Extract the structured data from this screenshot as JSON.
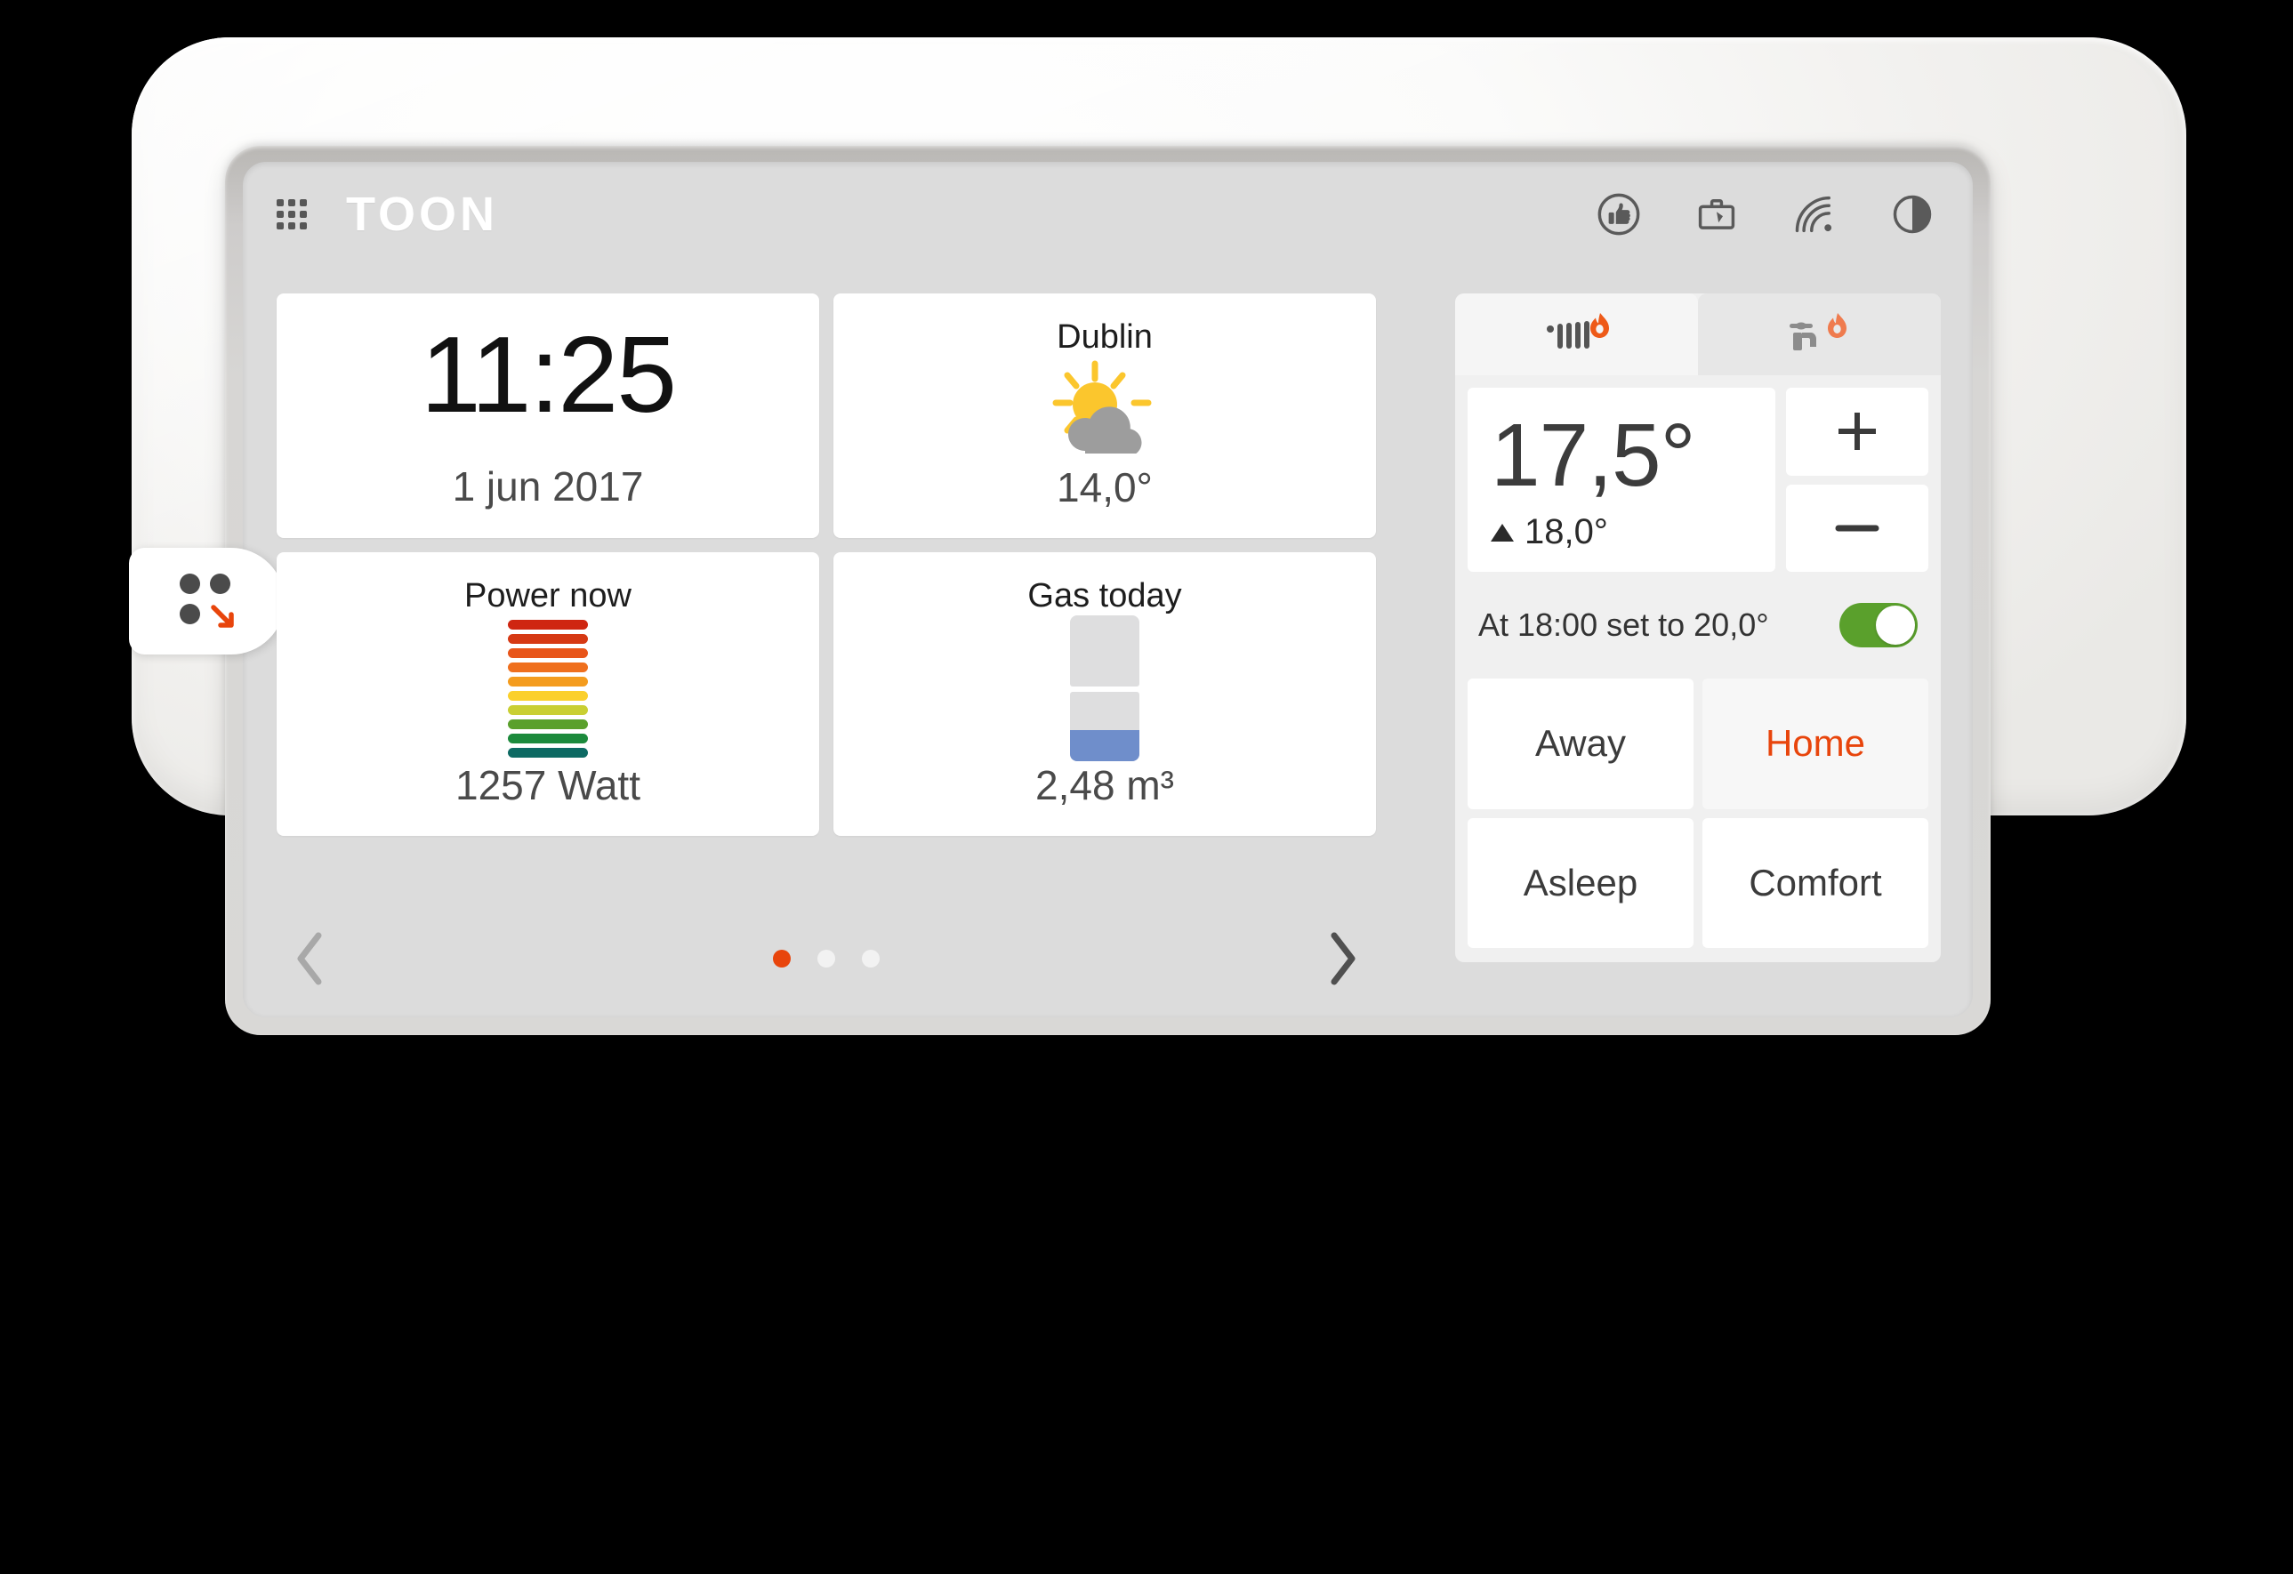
{
  "header": {
    "brand": "TOON",
    "menu_icon": "grid-menu-icon",
    "status_icons": [
      {
        "name": "thumbs-up-icon",
        "label": "Thumbs up"
      },
      {
        "name": "toolbox-icon",
        "label": "Toolbox"
      },
      {
        "name": "wifi-icon",
        "label": "Wi-Fi"
      },
      {
        "name": "contrast-icon",
        "label": "Contrast"
      }
    ]
  },
  "pull_tab": {
    "name": "quick-actions-tab",
    "glyph": "three-dots-with-arrow-icon"
  },
  "tiles": {
    "clock": {
      "time": "11:25",
      "date": "1 jun 2017"
    },
    "weather": {
      "title": "Dublin",
      "value": "14,0°",
      "icon": "sun-behind-cloud-icon",
      "sun_color": "#fbc62d",
      "cloud_color": "#9d9d9d"
    },
    "power": {
      "title": "Power now",
      "value": "1257 Watt",
      "icon": "energy-bars-icon",
      "bar_colors": [
        "#cf2611",
        "#d63914",
        "#e8551a",
        "#ef6f1d",
        "#f49c1e",
        "#fbd02c",
        "#c9cf33",
        "#5aa02c",
        "#1c8a3c",
        "#0d6a63"
      ]
    },
    "gas": {
      "title": "Gas today",
      "value": "2,48 m³",
      "icon": "gas-level-icon",
      "fill_color": "#6f8ecb",
      "empty_color": "#dededf",
      "fill_percent": 45
    }
  },
  "pagination": {
    "prev_icon": "chevron-left-icon",
    "next_icon": "chevron-right-icon",
    "dots": 3,
    "active_dot": 1,
    "active_color": "#e8450c",
    "inactive_color": "#f2f2f2"
  },
  "thermostat": {
    "tabs": [
      {
        "name": "heating-tab",
        "icon": "radiator-flame-icon",
        "active": true
      },
      {
        "name": "hot-water-tab",
        "icon": "tap-flame-icon",
        "active": false
      }
    ],
    "current_temperature": "17,5°",
    "setpoint": "18,0°",
    "setpoint_indicator": "up-triangle-icon",
    "increase_label": "+",
    "decrease_label": "−",
    "schedule_text": "At 18:00 set to 20,0°",
    "schedule_enabled": true,
    "toggle_on_color": "#5aa02c",
    "programs": [
      {
        "label": "Away",
        "active": false
      },
      {
        "label": "Home",
        "active": true
      },
      {
        "label": "Asleep",
        "active": false
      },
      {
        "label": "Comfort",
        "active": false
      }
    ],
    "active_program_color": "#e8450c"
  }
}
